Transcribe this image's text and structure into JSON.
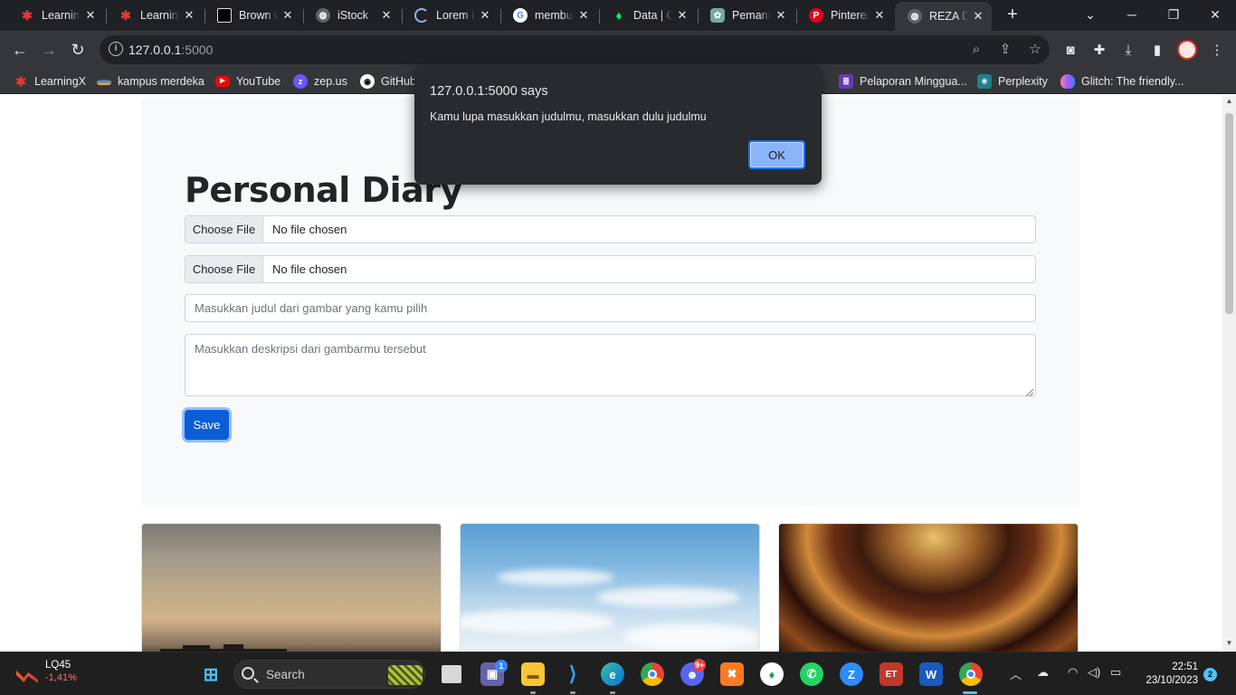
{
  "browser": {
    "tabs": [
      {
        "title": "LearningX",
        "icon": "learningx-icon",
        "color": "#e53935"
      },
      {
        "title": "LearningX",
        "icon": "learningx-icon",
        "color": "#e53935"
      },
      {
        "title": "Brown w",
        "icon": "unsplash-icon",
        "color": "#000000"
      },
      {
        "title": "iStock",
        "icon": "globe-icon",
        "color": "#9aa0a6"
      },
      {
        "title": "Lorem I",
        "icon": "loading-icon",
        "color": "#8ab4f8"
      },
      {
        "title": "membu",
        "icon": "google-icon",
        "color": "#4285f4"
      },
      {
        "title": "Data | C",
        "icon": "mongodb-icon",
        "color": "#00ed64"
      },
      {
        "title": "Pemanc",
        "icon": "chatgpt-icon",
        "color": "#74aa9c"
      },
      {
        "title": "Pinteres",
        "icon": "pinterest-icon",
        "color": "#e60023"
      },
      {
        "title": "REZA D",
        "icon": "globe-icon",
        "color": "#9aa0a6",
        "active": true
      }
    ],
    "url_host": "127.0.0.1",
    "url_port": ":5000",
    "bookmarks": [
      {
        "label": "LearningX",
        "icon": "learningx-icon",
        "color": "#e53935"
      },
      {
        "label": "kampus merdeka",
        "icon": "kampus-merdeka-icon",
        "color": "#2b6cb0"
      },
      {
        "label": "YouTube",
        "icon": "youtube-icon",
        "color": "#ff0000"
      },
      {
        "label": "zep.us",
        "icon": "zep-icon",
        "color": "#6758ff"
      },
      {
        "label": "GitHub",
        "icon": "github-icon",
        "color": "#ffffff"
      },
      {
        "label": "Pelaporan Minggua...",
        "icon": "form-icon",
        "color": "#673ab7"
      },
      {
        "label": "Perplexity",
        "icon": "perplexity-icon",
        "color": "#20808d"
      },
      {
        "label": "Glitch: The friendly...",
        "icon": "glitch-icon",
        "color": "#a259ff"
      }
    ]
  },
  "dialog": {
    "title": "127.0.0.1:5000 says",
    "message": "Kamu lupa masukkan judulmu, masukkan dulu judulmu",
    "ok_label": "OK"
  },
  "page": {
    "title": "Personal Diary",
    "file_inputs": [
      {
        "button": "Choose File",
        "status": "No file chosen"
      },
      {
        "button": "Choose File",
        "status": "No file chosen"
      }
    ],
    "title_input": {
      "value": "",
      "placeholder": "Masukkan judul dari gambar yang kamu pilih"
    },
    "desc_input": {
      "value": "",
      "placeholder": "Masukkan deskripsi dari gambarmu tersebut"
    },
    "save_label": "Save",
    "primary_color": "#0b5ed7"
  },
  "taskbar": {
    "weather": {
      "name": "LQ45",
      "change": "-1,41%"
    },
    "search_label": "Search",
    "teams_badge": "1",
    "discord_badge": "9+",
    "time": "22:51",
    "date": "23/10/2023",
    "notifications": "2"
  }
}
